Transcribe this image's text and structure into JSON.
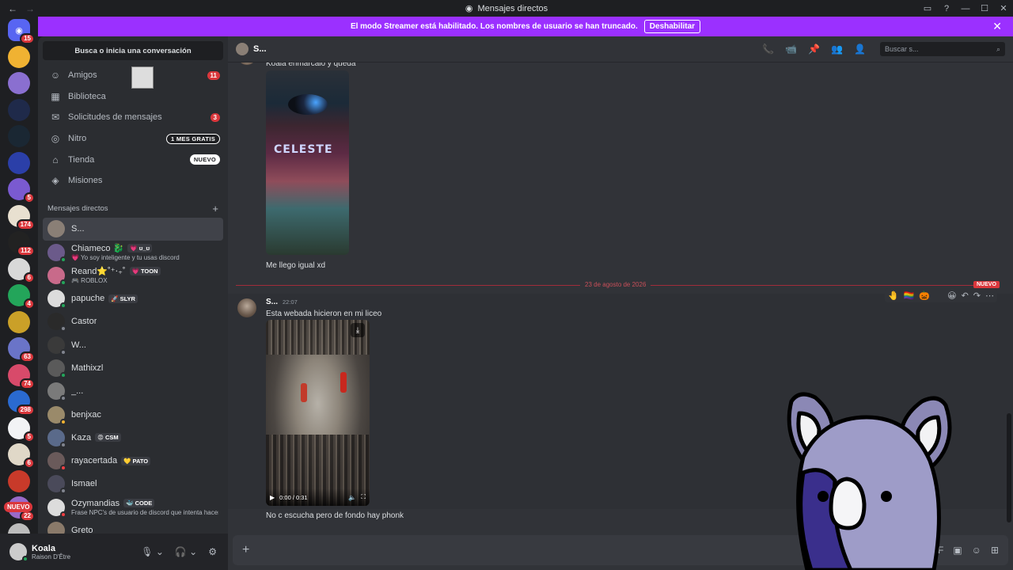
{
  "window": {
    "title": "Mensajes directos",
    "nav_back": "←",
    "nav_forward": "→",
    "controls": [
      "▭",
      "?",
      "—",
      "☐",
      "✕"
    ]
  },
  "banner": {
    "text": "El modo Streamer está habilitado. Los nombres de usuario se han truncado.",
    "button": "Deshabilitar",
    "close": "✕"
  },
  "rail": {
    "home_badge": "15",
    "servers": [
      {
        "color": "#f0b232",
        "badge": ""
      },
      {
        "color": "#8a6fd0",
        "badge": ""
      },
      {
        "color": "#1f2a4a",
        "badge": ""
      },
      {
        "color": "#1a2733",
        "badge": ""
      },
      {
        "color": "#2b3fa8",
        "badge": ""
      },
      {
        "color": "#7a5ad0",
        "badge": "5"
      },
      {
        "color": "#e8e0d0",
        "badge": "174"
      },
      {
        "color": "#222222",
        "badge": "112"
      },
      {
        "color": "#d8d8d8",
        "badge": "6"
      },
      {
        "color": "#23a55a",
        "badge": "4"
      },
      {
        "color": "#caa028",
        "badge": ""
      },
      {
        "color": "#6a74c8",
        "badge": "63"
      },
      {
        "color": "#d84a6a",
        "badge": "74"
      },
      {
        "color": "#2a6ad0",
        "badge": "298"
      },
      {
        "color": "#f2f3f5",
        "badge": "5"
      },
      {
        "color": "#e0d8c8",
        "badge": "6"
      },
      {
        "color": "#c83a2a",
        "badge": ""
      },
      {
        "color": "#9a6ac8",
        "badge": "22"
      },
      {
        "color": "#bcbcbc",
        "badge": ""
      }
    ],
    "nuevo": "NUEVO"
  },
  "sidebar": {
    "search_placeholder": "Busca o inicia una conversación",
    "nav": [
      {
        "icon": "☺",
        "label": "Amigos",
        "badge": "11"
      },
      {
        "icon": "▦",
        "label": "Biblioteca",
        "badge": ""
      },
      {
        "icon": "✉",
        "label": "Solicitudes de mensajes",
        "badge": "3"
      },
      {
        "icon": "◎",
        "label": "Nitro",
        "badge": "1 MES GRATIS"
      },
      {
        "icon": "⌂",
        "label": "Tienda",
        "badge": "NUEVO"
      },
      {
        "icon": "◈",
        "label": "Misiones",
        "badge": ""
      }
    ],
    "dm_header": "Mensajes directos",
    "dm_add": "+",
    "dms": [
      {
        "name": "S...",
        "sub": "",
        "tag": "",
        "color": "#8a7f76",
        "status": ""
      },
      {
        "name": "Chiameco 🐉",
        "sub": "💗 Yo soy inteligente y tu usas discord",
        "tag": "💗 ʊ_ʊ",
        "color": "#6b5a8a",
        "status": "#23a55a"
      },
      {
        "name": "Reand⭐˚⁺‧₊˚",
        "sub": "🎮 ROBLOX",
        "tag": "💗 TOON",
        "color": "#c86a8a",
        "status": "#23a55a"
      },
      {
        "name": "papuche",
        "sub": "",
        "tag": "🚀 SLYR",
        "color": "#dcdcdc",
        "status": "#23a55a"
      },
      {
        "name": "Castor",
        "sub": "",
        "tag": "",
        "color": "#2a2a2a",
        "status": "#80848e"
      },
      {
        "name": "W...",
        "sub": "",
        "tag": "",
        "color": "#3a3a3a",
        "status": "#80848e"
      },
      {
        "name": "Mathixzl",
        "sub": "",
        "tag": "",
        "color": "#5a5a5a",
        "status": "#23a55a"
      },
      {
        "name": "_...",
        "sub": "",
        "tag": "",
        "color": "#7a7a7a",
        "status": "#80848e"
      },
      {
        "name": "benjxac",
        "sub": "",
        "tag": "",
        "color": "#9a8a6a",
        "status": "#f0b232"
      },
      {
        "name": "Kaza",
        "sub": "",
        "tag": "😡 CSM",
        "color": "#5a6a8a",
        "status": "#80848e"
      },
      {
        "name": "rayacertada",
        "sub": "",
        "tag": "💛 PATO",
        "color": "#6a5a5a",
        "status": "#f23f43"
      },
      {
        "name": "Ismael",
        "sub": "",
        "tag": "",
        "color": "#4a4a5a",
        "status": "#80848e"
      },
      {
        "name": "Ozymandias",
        "sub": "Frase NPC's de usuario de discord que intenta hacers...",
        "tag": "🐳 CODE",
        "color": "#dcdcdc",
        "status": "#f23f43"
      },
      {
        "name": "Greto",
        "sub": "",
        "tag": "",
        "color": "#8a7a6a",
        "status": "#80848e"
      }
    ]
  },
  "user": {
    "name": "Koala",
    "status": "Raison D'Être",
    "mic": "🎙",
    "headset": "🎧",
    "settings": "⚙"
  },
  "chat": {
    "header_name": "S...",
    "search_placeholder": "Buscar s...",
    "header_icons": [
      "📞",
      "📹",
      "📌",
      "👥",
      "👤"
    ],
    "msg1_text": "Koala enmarcalo y queda",
    "msg1_image_logo": "CELESTE",
    "msg2_text": "Me llego igual xd",
    "divider_date": "23 de agosto de 2026",
    "divider_new": "NUEVO",
    "author": "S...",
    "time": "22:07",
    "msg3_text": "Esta webada hicieron en mi liceo",
    "video_time": "0:00 / 0:31",
    "msg4_text": "No c escucha pero de fondo hay phonk",
    "reactions": [
      "🤚",
      "🏳️‍🌈",
      "🎃"
    ],
    "tools": [
      "😀",
      "↶",
      "↷",
      "⋯"
    ],
    "composer_plus": "+",
    "composer_tools": [
      "🎁",
      "GIF",
      "▣",
      "☺",
      "⊞"
    ]
  },
  "colors": {
    "accent": "#5865f2",
    "banner": "#9b30ff",
    "danger": "#da373c",
    "online": "#23a55a"
  }
}
